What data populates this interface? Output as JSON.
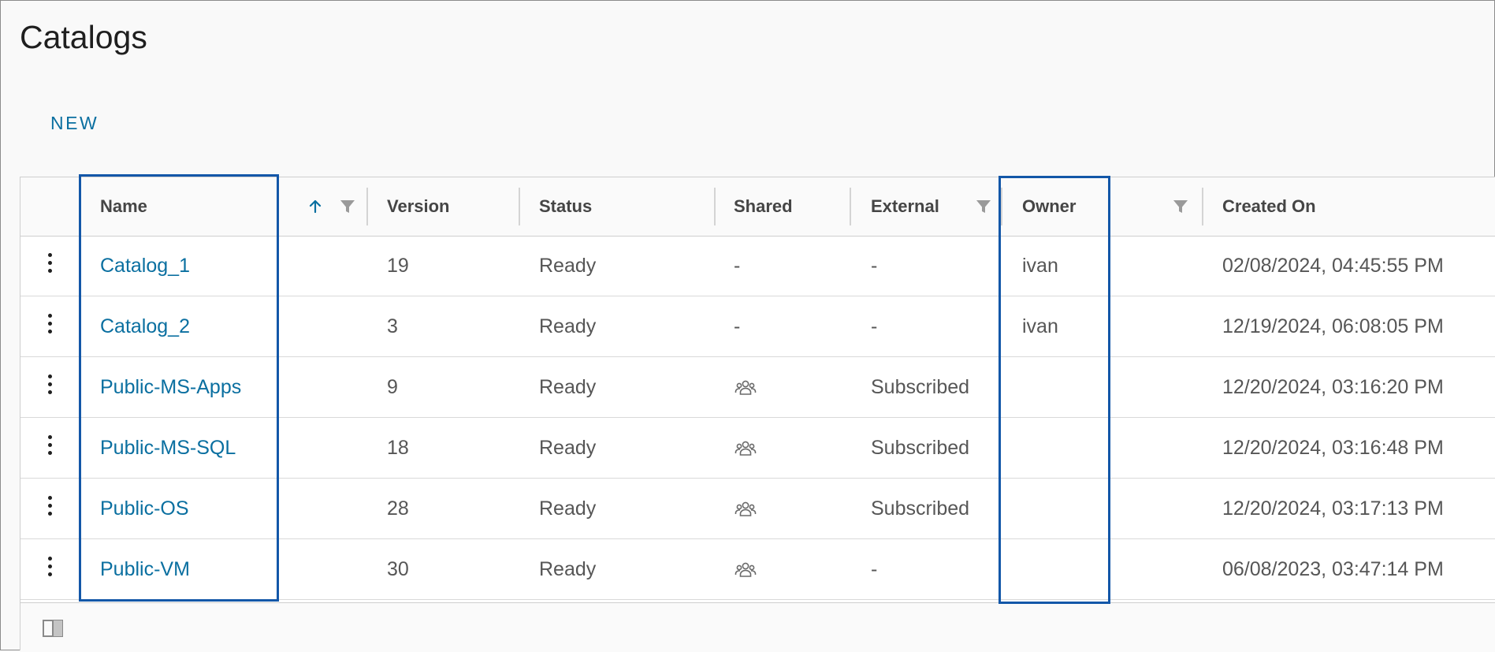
{
  "page": {
    "title": "Catalogs"
  },
  "toolbar": {
    "new_label": "NEW"
  },
  "columns": {
    "name": "Name",
    "version": "Version",
    "status": "Status",
    "shared": "Shared",
    "external": "External",
    "owner": "Owner",
    "created_on": "Created On"
  },
  "sort": {
    "column": "Name",
    "direction": "ascending"
  },
  "rows": [
    {
      "name": "Catalog_1",
      "version": "19",
      "status": "Ready",
      "shared": "-",
      "shared_icon": false,
      "external": "-",
      "owner": "ivan",
      "created_on": "02/08/2024, 04:45:55 PM"
    },
    {
      "name": "Catalog_2",
      "version": "3",
      "status": "Ready",
      "shared": "-",
      "shared_icon": false,
      "external": "-",
      "owner": "ivan",
      "created_on": "12/19/2024, 06:08:05 PM"
    },
    {
      "name": "Public-MS-Apps",
      "version": "9",
      "status": "Ready",
      "shared": "",
      "shared_icon": true,
      "external": "Subscribed",
      "owner": "",
      "created_on": "12/20/2024, 03:16:20 PM"
    },
    {
      "name": "Public-MS-SQL",
      "version": "18",
      "status": "Ready",
      "shared": "",
      "shared_icon": true,
      "external": "Subscribed",
      "owner": "",
      "created_on": "12/20/2024, 03:16:48 PM"
    },
    {
      "name": "Public-OS",
      "version": "28",
      "status": "Ready",
      "shared": "",
      "shared_icon": true,
      "external": "Subscribed",
      "owner": "",
      "created_on": "12/20/2024, 03:17:13 PM"
    },
    {
      "name": "Public-VM",
      "version": "30",
      "status": "Ready",
      "shared": "",
      "shared_icon": true,
      "external": "-",
      "owner": "",
      "created_on": "06/08/2023, 03:47:14 PM"
    }
  ],
  "colors": {
    "link": "#0a6fa0",
    "highlight_box": "#1357a8",
    "header_text": "#454545",
    "body_text": "#565656"
  },
  "icons": {
    "row_actions": "vertical-ellipsis-icon",
    "sort": "arrow-up-icon",
    "filter": "filter-icon",
    "shared": "users-group-icon",
    "column_toggle": "column-toggle-icon"
  }
}
